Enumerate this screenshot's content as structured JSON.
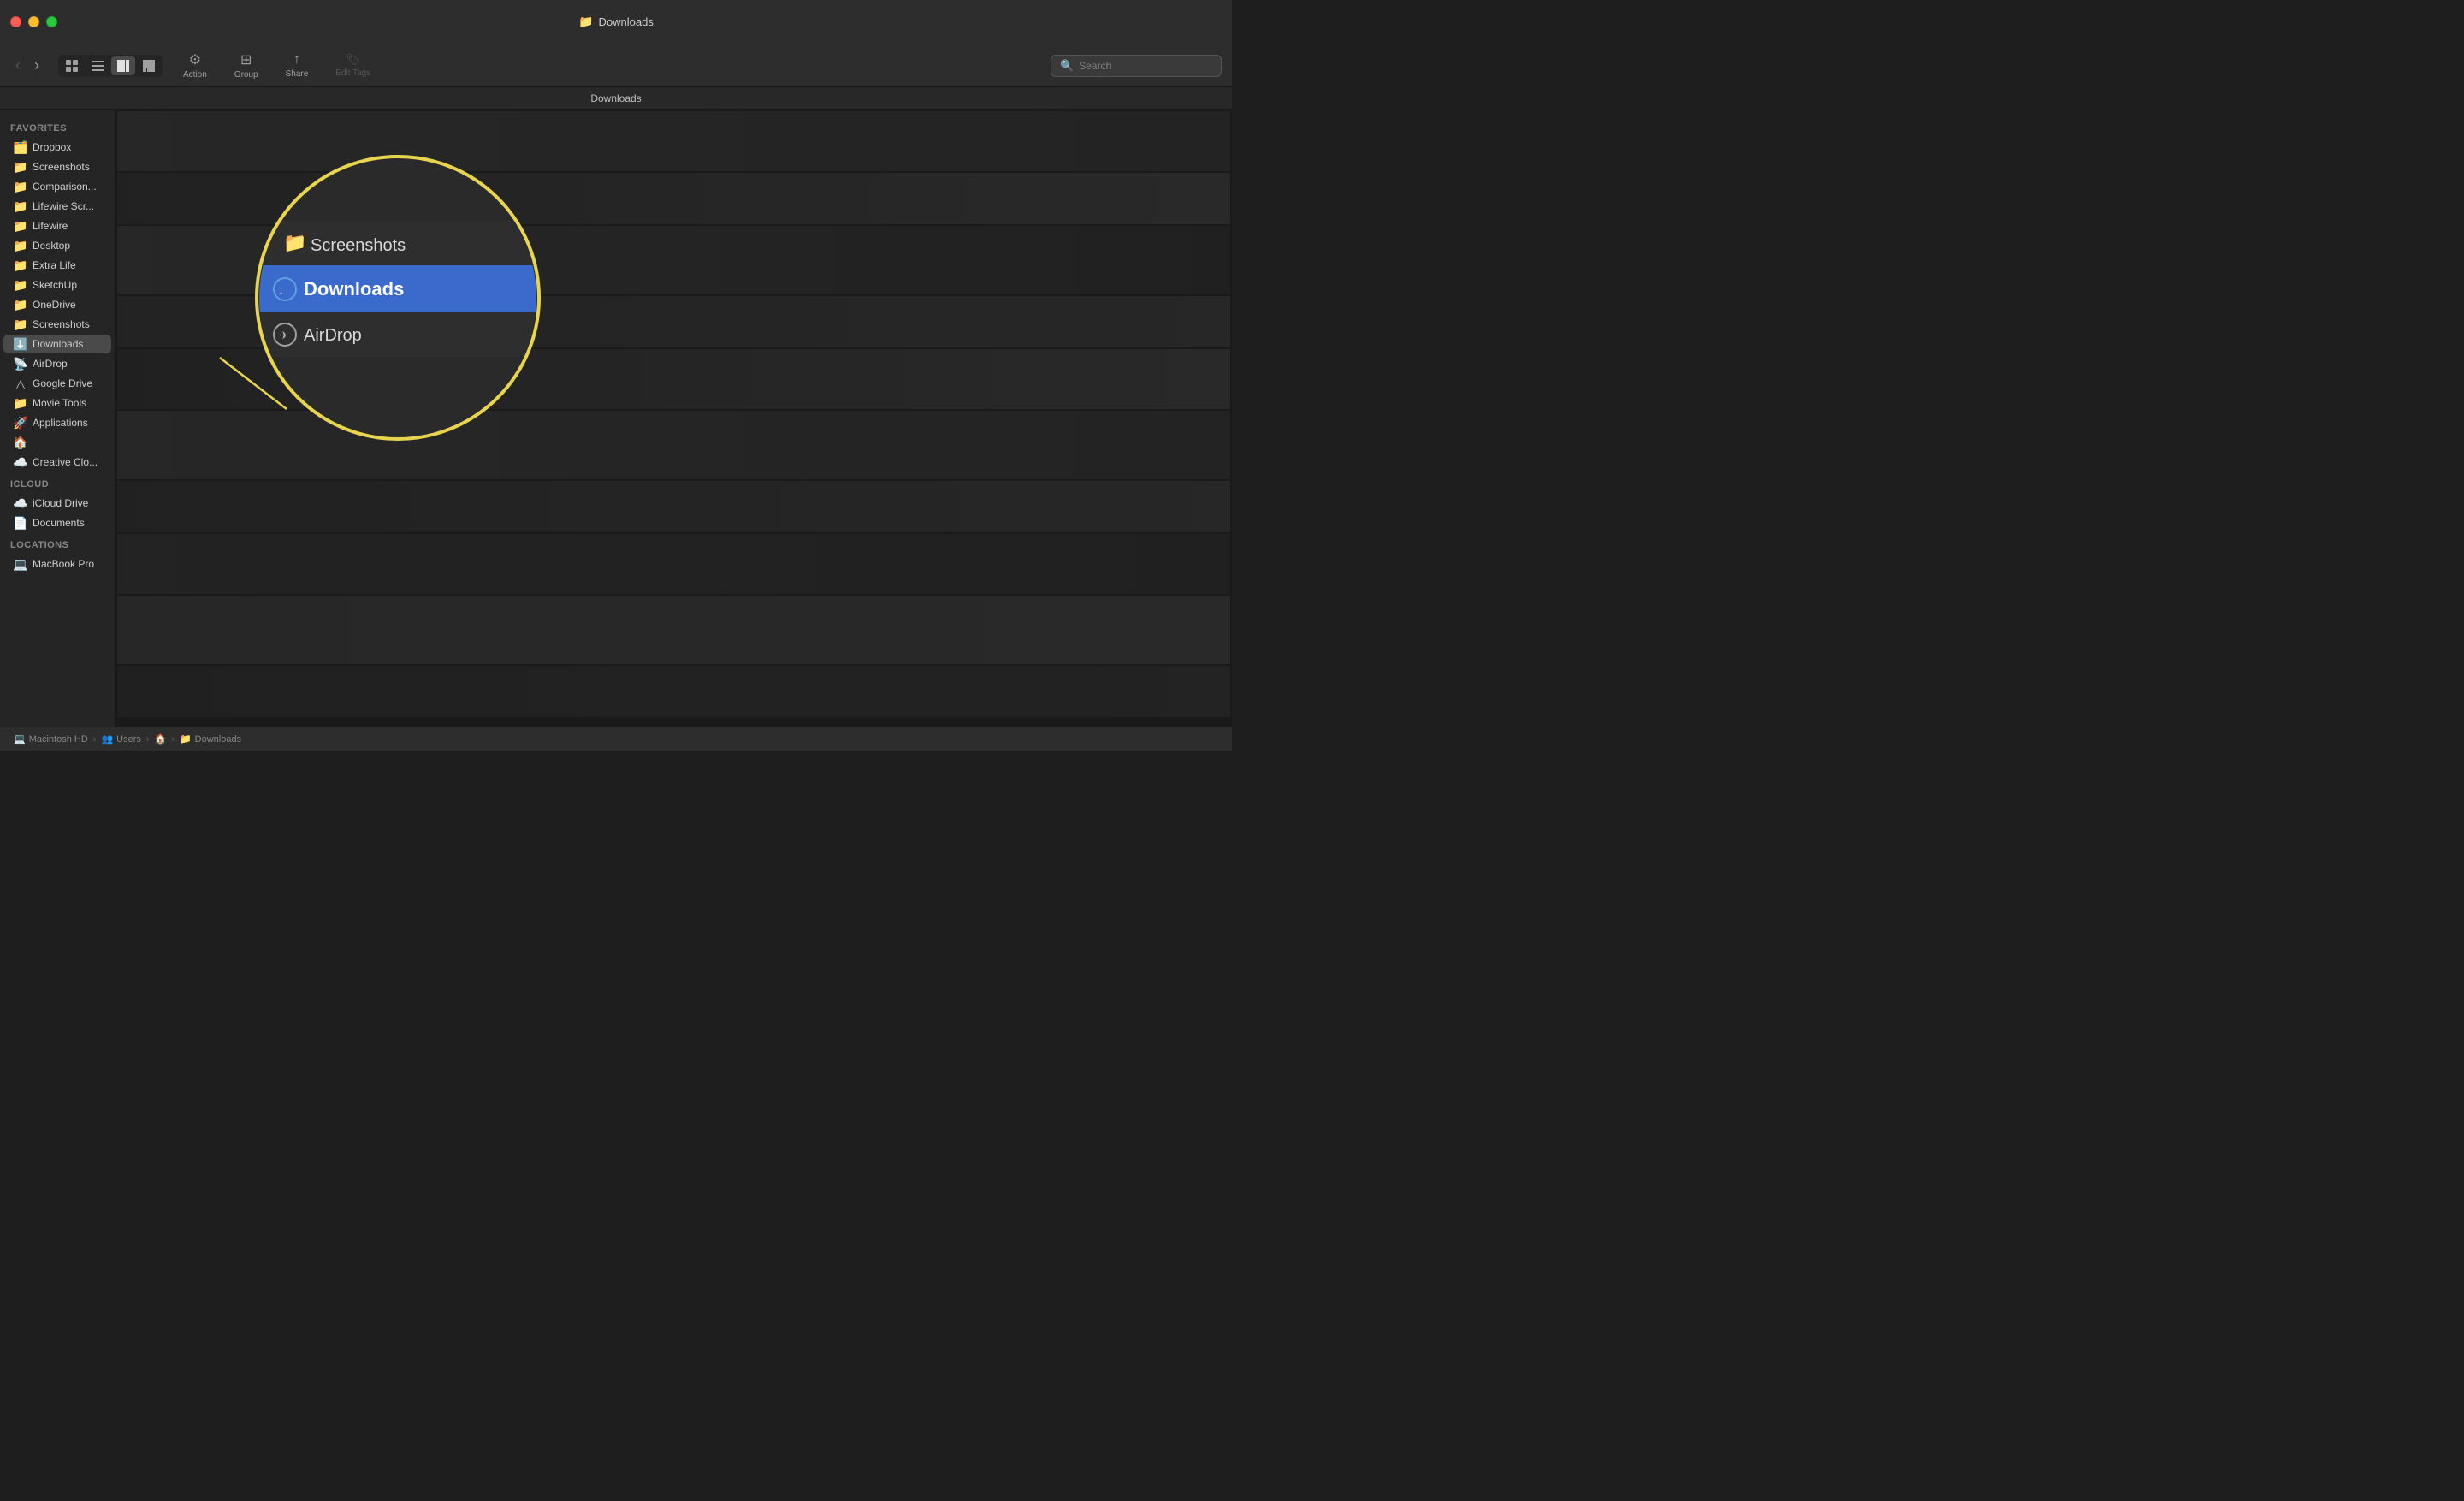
{
  "window": {
    "title": "Downloads",
    "title_icon": "📁"
  },
  "titlebar": {
    "traffic_lights": {
      "close_label": "close",
      "minimize_label": "minimize",
      "maximize_label": "maximize"
    }
  },
  "toolbar": {
    "back_label": "‹",
    "forward_label": "›",
    "nav_label": "Back/Forward",
    "view_label": "View",
    "action_label": "Action",
    "group_label": "Group",
    "share_label": "Share",
    "edit_tags_label": "Edit Tags",
    "search_placeholder": "Search",
    "search_label": "Search"
  },
  "pathbar": {
    "text": "Downloads"
  },
  "sidebar": {
    "sections": [
      {
        "header": "Favorites",
        "items": [
          {
            "label": "Dropbox",
            "icon": "🗂️",
            "type": "folder"
          },
          {
            "label": "Screenshots",
            "icon": "📁",
            "type": "folder"
          },
          {
            "label": "Comparison...",
            "icon": "📁",
            "type": "folder"
          },
          {
            "label": "Lifewire Scr...",
            "icon": "📁",
            "type": "folder"
          },
          {
            "label": "Lifewire",
            "icon": "📁",
            "type": "folder"
          },
          {
            "label": "Desktop",
            "icon": "📁",
            "type": "folder"
          },
          {
            "label": "Extra Life",
            "icon": "📁",
            "type": "folder"
          },
          {
            "label": "SketchUp",
            "icon": "📁",
            "type": "folder"
          },
          {
            "label": "OneDrive",
            "icon": "📁",
            "type": "folder"
          },
          {
            "label": "Screenshots",
            "icon": "📁",
            "type": "folder"
          },
          {
            "label": "Downloads",
            "icon": "⬇️",
            "type": "downloads",
            "active": true
          },
          {
            "label": "AirDrop",
            "icon": "📡",
            "type": "airdrop"
          },
          {
            "label": "Google Drive",
            "icon": "△",
            "type": "drive"
          },
          {
            "label": "Movie Tools",
            "icon": "📁",
            "type": "folder"
          },
          {
            "label": "Applications",
            "icon": "🚀",
            "type": "apps"
          },
          {
            "label": "",
            "icon": "🏠",
            "type": "home"
          },
          {
            "label": "Creative Clo...",
            "icon": "☁️",
            "type": "cloud"
          }
        ]
      },
      {
        "header": "iCloud",
        "items": [
          {
            "label": "iCloud Drive",
            "icon": "☁️",
            "type": "cloud"
          },
          {
            "label": "Documents",
            "icon": "📄",
            "type": "doc"
          }
        ]
      },
      {
        "header": "Locations",
        "items": [
          {
            "label": "MacBook Pro",
            "icon": "💻",
            "type": "computer"
          }
        ]
      }
    ]
  },
  "magnifier": {
    "items": [
      {
        "label": "Screenshots",
        "icon": "folder",
        "highlighted": false
      },
      {
        "label": "Downloads",
        "icon": "download",
        "highlighted": true
      },
      {
        "label": "AirDrop",
        "icon": "airdrop",
        "highlighted": false
      }
    ]
  },
  "statusbar": {
    "path_parts": [
      {
        "icon": "💻",
        "label": "Macintosh HD"
      },
      {
        "icon": "📁",
        "label": "Users"
      },
      {
        "icon": "🏠",
        "label": ""
      },
      {
        "icon": "📁",
        "label": "Downloads"
      }
    ]
  }
}
